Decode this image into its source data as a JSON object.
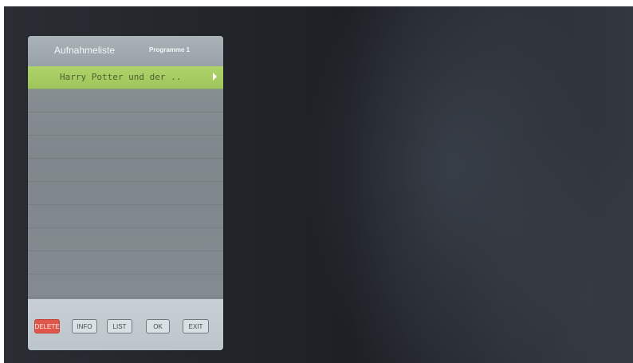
{
  "window": {
    "title": "Aufnahmeliste",
    "subtitle": "Programme 1"
  },
  "list": {
    "items": [
      {
        "label": "Harry Potter und der ..",
        "selected": true
      },
      {
        "label": ""
      },
      {
        "label": ""
      },
      {
        "label": ""
      },
      {
        "label": ""
      },
      {
        "label": ""
      },
      {
        "label": ""
      },
      {
        "label": ""
      },
      {
        "label": ""
      },
      {
        "label": ""
      }
    ]
  },
  "buttons": {
    "delete": "DELETE",
    "info": "INFO",
    "list": "LIST",
    "ok": "OK",
    "exit": "EXIT"
  },
  "colors": {
    "selected_row": "#a6cd62",
    "delete_button": "#e0564a"
  }
}
